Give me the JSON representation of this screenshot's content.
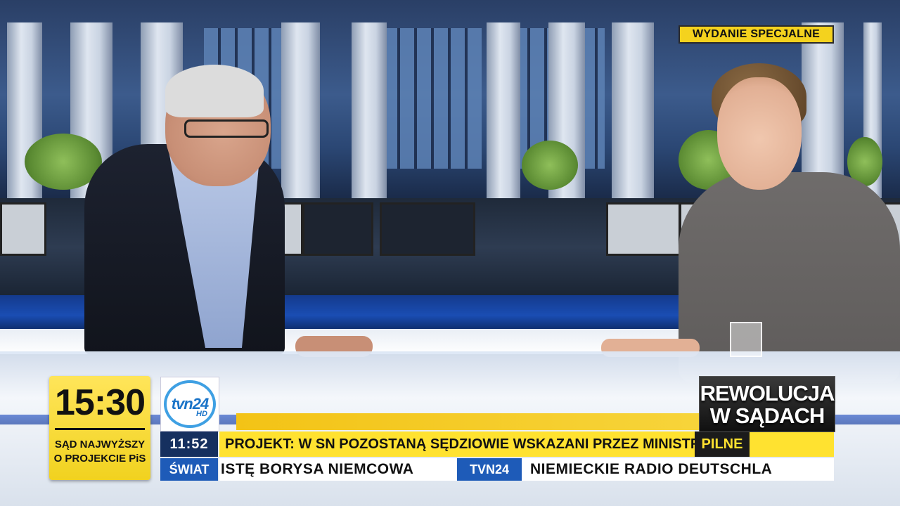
{
  "badge": {
    "label": "WYDANIE SPECJALNE"
  },
  "clock": {
    "time": "15:30",
    "caption_line1": "SĄD NAJWYŻSZY",
    "caption_line2": "O PROJEKCIE PiS"
  },
  "channel_logo": {
    "text": "tvn24",
    "suffix": "HD"
  },
  "headline_bar": {
    "time": "11:52",
    "text": "PROJEKT: W SN POZOSTANĄ SĘDZIOWIE WSKAZANI PRZEZ MINISTRA SPRAW",
    "urgent_label": "PILNE"
  },
  "ticker": {
    "section_label": "ŚWIAT",
    "item1": "ISTĘ BORYSA NIEMCOWA",
    "badge": "TVN24",
    "item2": "NIEMIECKIE RADIO DEUTSCHLA"
  },
  "program_promo": {
    "line1": "REWOLUCJA",
    "line2": "W SĄDACH"
  },
  "colors": {
    "ticker_yellow": "#ffe230",
    "ticker_blue": "#1e5bb8",
    "time_box_navy": "#16305f",
    "badge_yellow": "#f4d21e"
  }
}
